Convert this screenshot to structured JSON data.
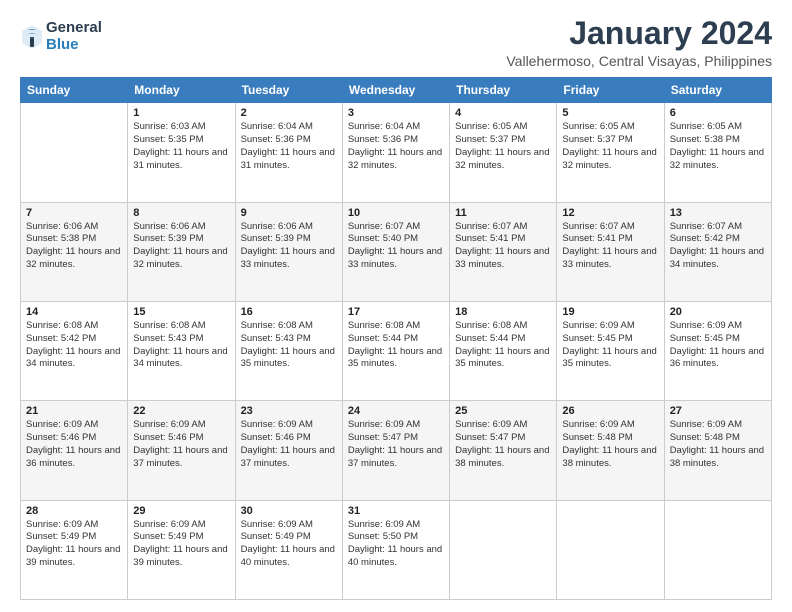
{
  "header": {
    "logo": {
      "general": "General",
      "blue": "Blue"
    },
    "title": "January 2024",
    "location": "Vallehermoso, Central Visayas, Philippines"
  },
  "days_of_week": [
    "Sunday",
    "Monday",
    "Tuesday",
    "Wednesday",
    "Thursday",
    "Friday",
    "Saturday"
  ],
  "weeks": [
    [
      {
        "day": "",
        "sunrise": "",
        "sunset": "",
        "daylight": ""
      },
      {
        "day": "1",
        "sunrise": "Sunrise: 6:03 AM",
        "sunset": "Sunset: 5:35 PM",
        "daylight": "Daylight: 11 hours and 31 minutes."
      },
      {
        "day": "2",
        "sunrise": "Sunrise: 6:04 AM",
        "sunset": "Sunset: 5:36 PM",
        "daylight": "Daylight: 11 hours and 31 minutes."
      },
      {
        "day": "3",
        "sunrise": "Sunrise: 6:04 AM",
        "sunset": "Sunset: 5:36 PM",
        "daylight": "Daylight: 11 hours and 32 minutes."
      },
      {
        "day": "4",
        "sunrise": "Sunrise: 6:05 AM",
        "sunset": "Sunset: 5:37 PM",
        "daylight": "Daylight: 11 hours and 32 minutes."
      },
      {
        "day": "5",
        "sunrise": "Sunrise: 6:05 AM",
        "sunset": "Sunset: 5:37 PM",
        "daylight": "Daylight: 11 hours and 32 minutes."
      },
      {
        "day": "6",
        "sunrise": "Sunrise: 6:05 AM",
        "sunset": "Sunset: 5:38 PM",
        "daylight": "Daylight: 11 hours and 32 minutes."
      }
    ],
    [
      {
        "day": "7",
        "sunrise": "Sunrise: 6:06 AM",
        "sunset": "Sunset: 5:38 PM",
        "daylight": "Daylight: 11 hours and 32 minutes."
      },
      {
        "day": "8",
        "sunrise": "Sunrise: 6:06 AM",
        "sunset": "Sunset: 5:39 PM",
        "daylight": "Daylight: 11 hours and 32 minutes."
      },
      {
        "day": "9",
        "sunrise": "Sunrise: 6:06 AM",
        "sunset": "Sunset: 5:39 PM",
        "daylight": "Daylight: 11 hours and 33 minutes."
      },
      {
        "day": "10",
        "sunrise": "Sunrise: 6:07 AM",
        "sunset": "Sunset: 5:40 PM",
        "daylight": "Daylight: 11 hours and 33 minutes."
      },
      {
        "day": "11",
        "sunrise": "Sunrise: 6:07 AM",
        "sunset": "Sunset: 5:41 PM",
        "daylight": "Daylight: 11 hours and 33 minutes."
      },
      {
        "day": "12",
        "sunrise": "Sunrise: 6:07 AM",
        "sunset": "Sunset: 5:41 PM",
        "daylight": "Daylight: 11 hours and 33 minutes."
      },
      {
        "day": "13",
        "sunrise": "Sunrise: 6:07 AM",
        "sunset": "Sunset: 5:42 PM",
        "daylight": "Daylight: 11 hours and 34 minutes."
      }
    ],
    [
      {
        "day": "14",
        "sunrise": "Sunrise: 6:08 AM",
        "sunset": "Sunset: 5:42 PM",
        "daylight": "Daylight: 11 hours and 34 minutes."
      },
      {
        "day": "15",
        "sunrise": "Sunrise: 6:08 AM",
        "sunset": "Sunset: 5:43 PM",
        "daylight": "Daylight: 11 hours and 34 minutes."
      },
      {
        "day": "16",
        "sunrise": "Sunrise: 6:08 AM",
        "sunset": "Sunset: 5:43 PM",
        "daylight": "Daylight: 11 hours and 35 minutes."
      },
      {
        "day": "17",
        "sunrise": "Sunrise: 6:08 AM",
        "sunset": "Sunset: 5:44 PM",
        "daylight": "Daylight: 11 hours and 35 minutes."
      },
      {
        "day": "18",
        "sunrise": "Sunrise: 6:08 AM",
        "sunset": "Sunset: 5:44 PM",
        "daylight": "Daylight: 11 hours and 35 minutes."
      },
      {
        "day": "19",
        "sunrise": "Sunrise: 6:09 AM",
        "sunset": "Sunset: 5:45 PM",
        "daylight": "Daylight: 11 hours and 35 minutes."
      },
      {
        "day": "20",
        "sunrise": "Sunrise: 6:09 AM",
        "sunset": "Sunset: 5:45 PM",
        "daylight": "Daylight: 11 hours and 36 minutes."
      }
    ],
    [
      {
        "day": "21",
        "sunrise": "Sunrise: 6:09 AM",
        "sunset": "Sunset: 5:46 PM",
        "daylight": "Daylight: 11 hours and 36 minutes."
      },
      {
        "day": "22",
        "sunrise": "Sunrise: 6:09 AM",
        "sunset": "Sunset: 5:46 PM",
        "daylight": "Daylight: 11 hours and 37 minutes."
      },
      {
        "day": "23",
        "sunrise": "Sunrise: 6:09 AM",
        "sunset": "Sunset: 5:46 PM",
        "daylight": "Daylight: 11 hours and 37 minutes."
      },
      {
        "day": "24",
        "sunrise": "Sunrise: 6:09 AM",
        "sunset": "Sunset: 5:47 PM",
        "daylight": "Daylight: 11 hours and 37 minutes."
      },
      {
        "day": "25",
        "sunrise": "Sunrise: 6:09 AM",
        "sunset": "Sunset: 5:47 PM",
        "daylight": "Daylight: 11 hours and 38 minutes."
      },
      {
        "day": "26",
        "sunrise": "Sunrise: 6:09 AM",
        "sunset": "Sunset: 5:48 PM",
        "daylight": "Daylight: 11 hours and 38 minutes."
      },
      {
        "day": "27",
        "sunrise": "Sunrise: 6:09 AM",
        "sunset": "Sunset: 5:48 PM",
        "daylight": "Daylight: 11 hours and 38 minutes."
      }
    ],
    [
      {
        "day": "28",
        "sunrise": "Sunrise: 6:09 AM",
        "sunset": "Sunset: 5:49 PM",
        "daylight": "Daylight: 11 hours and 39 minutes."
      },
      {
        "day": "29",
        "sunrise": "Sunrise: 6:09 AM",
        "sunset": "Sunset: 5:49 PM",
        "daylight": "Daylight: 11 hours and 39 minutes."
      },
      {
        "day": "30",
        "sunrise": "Sunrise: 6:09 AM",
        "sunset": "Sunset: 5:49 PM",
        "daylight": "Daylight: 11 hours and 40 minutes."
      },
      {
        "day": "31",
        "sunrise": "Sunrise: 6:09 AM",
        "sunset": "Sunset: 5:50 PM",
        "daylight": "Daylight: 11 hours and 40 minutes."
      },
      {
        "day": "",
        "sunrise": "",
        "sunset": "",
        "daylight": ""
      },
      {
        "day": "",
        "sunrise": "",
        "sunset": "",
        "daylight": ""
      },
      {
        "day": "",
        "sunrise": "",
        "sunset": "",
        "daylight": ""
      }
    ]
  ]
}
